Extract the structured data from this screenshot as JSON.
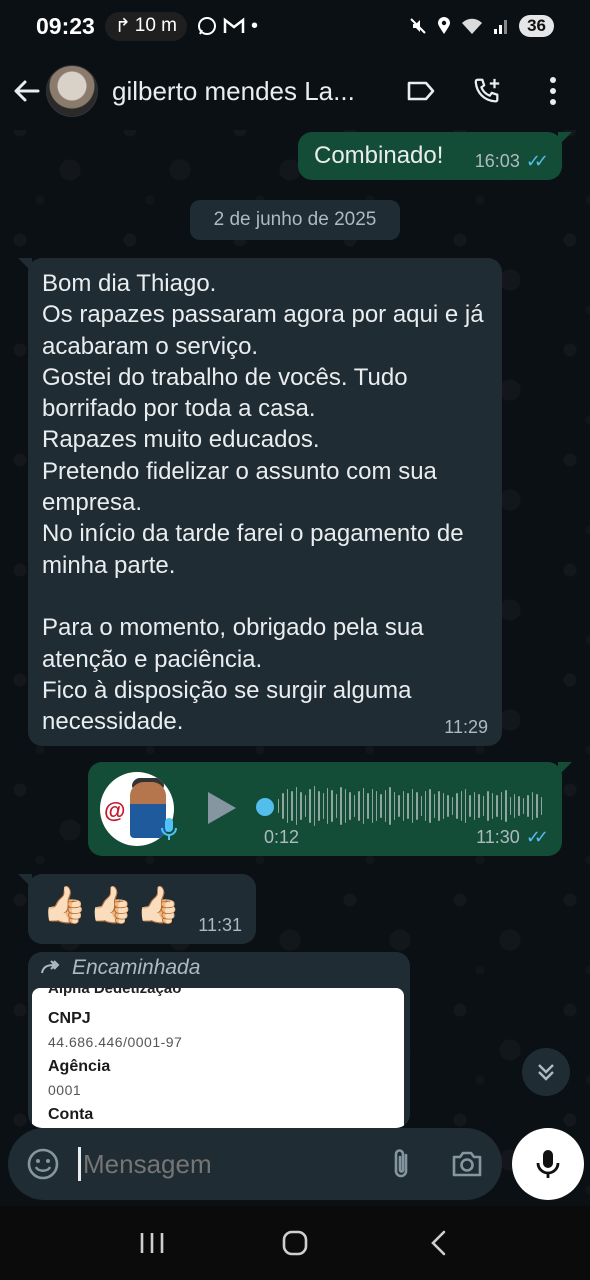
{
  "status_bar": {
    "time": "09:23",
    "pill_text": "10 m",
    "battery": "36",
    "notification_icons": [
      "whatsapp-icon",
      "gmail-icon",
      "dot"
    ]
  },
  "header": {
    "contact_name": "gilberto mendes La..."
  },
  "messages": {
    "m1": {
      "text": "Combinado!",
      "time": "16:03"
    },
    "date_chip": "2 de junho de 2025",
    "m2": {
      "text": "Bom dia Thiago.\nOs rapazes passaram agora por aqui e já acabaram o serviço.\nGostei do trabalho de vocês. Tudo borrifado por toda a casa.\nRapazes muito educados.\nPretendo fidelizar o assunto com sua empresa.\nNo início da tarde farei o pagamento de minha parte.\n\nPara o momento, obrigado pela sua atenção e paciência.\nFico à disposição se surgir alguma necessidade.",
      "time": "11:29"
    },
    "m3": {
      "duration": "0:12",
      "time": "11:30"
    },
    "m4": {
      "emoji": "👍🏻👍🏻👍🏻",
      "time": "11:31"
    },
    "m5": {
      "forwarded_label": "Encaminhada",
      "doc": {
        "company": "Alpha Dedetização",
        "cnpj_label": "CNPJ",
        "cnpj_value": "44.686.446/0001-97",
        "agencia_label": "Agência",
        "agencia_value": "0001",
        "conta_label": "Conta"
      }
    }
  },
  "input": {
    "placeholder": "Mensagem"
  },
  "colors": {
    "outgoing_bubble": "#144d37",
    "incoming_bubble": "#1f2c33",
    "read_ticks": "#53bdeb",
    "background": "#0b1014"
  }
}
